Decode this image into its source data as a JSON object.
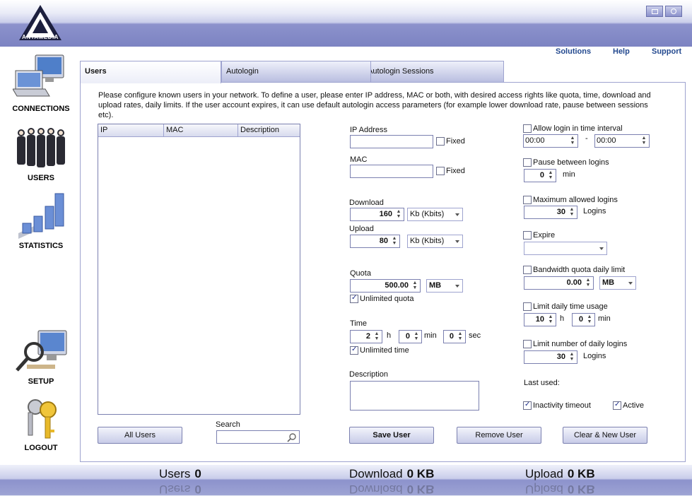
{
  "header": {
    "logo_text": "ANTAMEDIA"
  },
  "top_links": {
    "solutions": "Solutions",
    "help": "Help",
    "support": "Support"
  },
  "sidebar": {
    "connections": "CONNECTIONS",
    "users": "USERS",
    "statistics": "STATISTICS",
    "setup": "SETUP",
    "logout": "LOGOUT"
  },
  "tabs": {
    "users": "Users",
    "autologin": "Autologin",
    "sessions": "Autologin Sessions"
  },
  "intro": "Please configure known users in your network. To define a user, please enter IP address, MAC or both, with desired access rights like quota, time, download and upload rates, daily limits. If the user account expires, it can use default autologin access parameters (for example lower download rate, pause between sessions etc).",
  "table": {
    "columns": [
      "IP",
      "MAC",
      "Description"
    ],
    "rows": []
  },
  "buttons": {
    "all_users": "All Users",
    "save_user": "Save User",
    "remove_user": "Remove User",
    "clear_new_user": "Clear & New User"
  },
  "search": {
    "label": "Search",
    "value": ""
  },
  "form": {
    "ip_label": "IP Address",
    "ip_value": "",
    "ip_fixed": "Fixed",
    "mac_label": "MAC",
    "mac_value": "",
    "mac_fixed": "Fixed",
    "download_label": "Download",
    "download_value": "160",
    "download_unit": "Kb (Kbits)",
    "upload_label": "Upload",
    "upload_value": "80",
    "upload_unit": "Kb (Kbits)",
    "quota_label": "Quota",
    "quota_value": "500.00",
    "quota_unit": "MB",
    "unlimited_quota": "Unlimited quota",
    "time_label": "Time",
    "time_h": "2",
    "h": "h",
    "time_min": "0",
    "min": "min",
    "time_sec": "0",
    "sec": "sec",
    "unlimited_time": "Unlimited time",
    "description_label": "Description",
    "description_value": ""
  },
  "right": {
    "allow_interval": "Allow login in time interval",
    "interval_from": "00:00",
    "interval_sep": "-",
    "interval_to": "00:00",
    "pause_label": "Pause between logins",
    "pause_value": "0",
    "pause_unit": "min",
    "max_logins_label": "Maximum allowed logins",
    "max_logins_value": "30",
    "max_logins_unit": "Logins",
    "expire_label": "Expire",
    "expire_value": "",
    "bw_quota_label": "Bandwidth quota daily limit",
    "bw_quota_value": "0.00",
    "bw_quota_unit": "MB",
    "daily_time_label": "Limit daily time usage",
    "daily_h": "10",
    "h": "h",
    "daily_min": "0",
    "min": "min",
    "daily_logins_label": "Limit number of daily logins",
    "daily_logins_value": "30",
    "daily_logins_unit": "Logins",
    "last_used": "Last used:",
    "inactivity_timeout": "Inactivity timeout",
    "active": "Active"
  },
  "footer": {
    "users_label": "Users",
    "users_value": "0",
    "download_label": "Download",
    "download_value": "0 KB",
    "upload_label": "Upload",
    "upload_value": "0 KB"
  }
}
